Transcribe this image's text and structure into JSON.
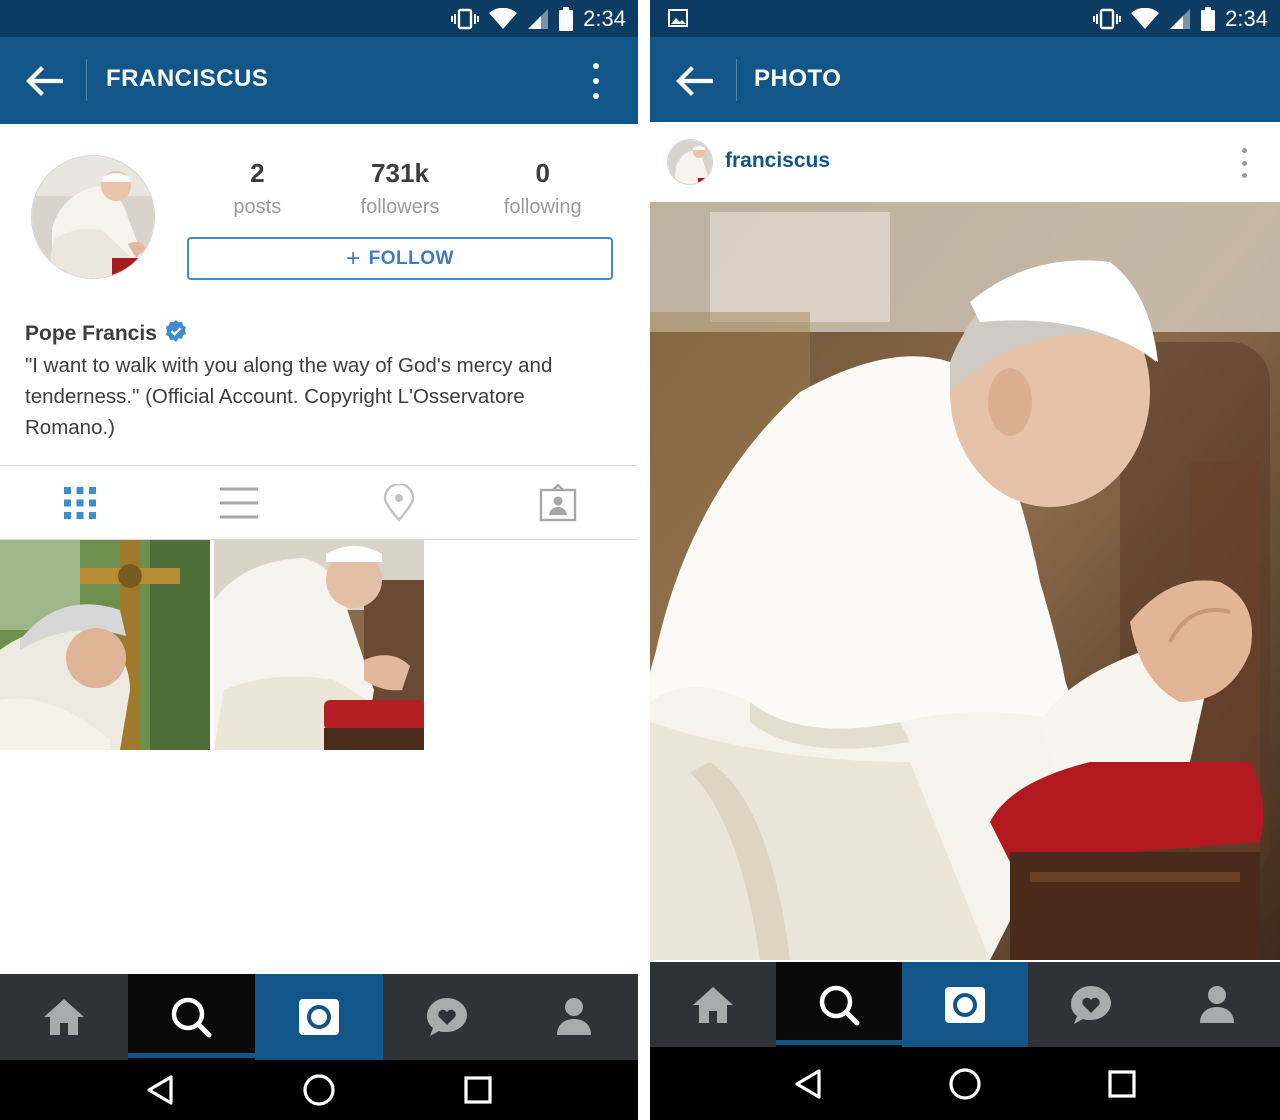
{
  "status_bar": {
    "time": "2:34",
    "icons": [
      "vibrate-icon",
      "wifi-icon",
      "signal-icon",
      "battery-icon"
    ],
    "notification_icon": "image-icon"
  },
  "profile_screen": {
    "title": "FRANCISCUS",
    "stats": [
      {
        "value": "2",
        "label": "posts"
      },
      {
        "value": "731k",
        "label": "followers"
      },
      {
        "value": "0",
        "label": "following"
      }
    ],
    "follow_button": {
      "plus": "+",
      "label": "FOLLOW"
    },
    "full_name": "Pope Francis",
    "verified": true,
    "bio": "\"I want to walk with you along the way of God's mercy and tenderness.\" (Official Account. Copyright L'Osservatore Romano.)",
    "tabs": [
      "grid-view-icon",
      "list-view-icon",
      "location-pin-icon",
      "tagged-photos-icon"
    ],
    "active_tab": 0,
    "posts_grid_count": 2
  },
  "photo_screen": {
    "title": "PHOTO",
    "username": "franciscus"
  },
  "bottom_nav": {
    "items": [
      "home-icon",
      "search-icon",
      "camera-icon",
      "activity-heart-icon",
      "profile-icon"
    ],
    "selected": 1
  },
  "system_nav": {
    "items": [
      "back-triangle-icon",
      "home-circle-icon",
      "recents-square-icon"
    ]
  },
  "colors": {
    "status_bar": "#0c3b63",
    "app_bar": "#125689",
    "accent": "#3f8bd0",
    "verified": "#3f8bd0",
    "bottom_bar": "#2f3236",
    "text": "#3d3d3d",
    "muted": "#9a9a9a"
  }
}
